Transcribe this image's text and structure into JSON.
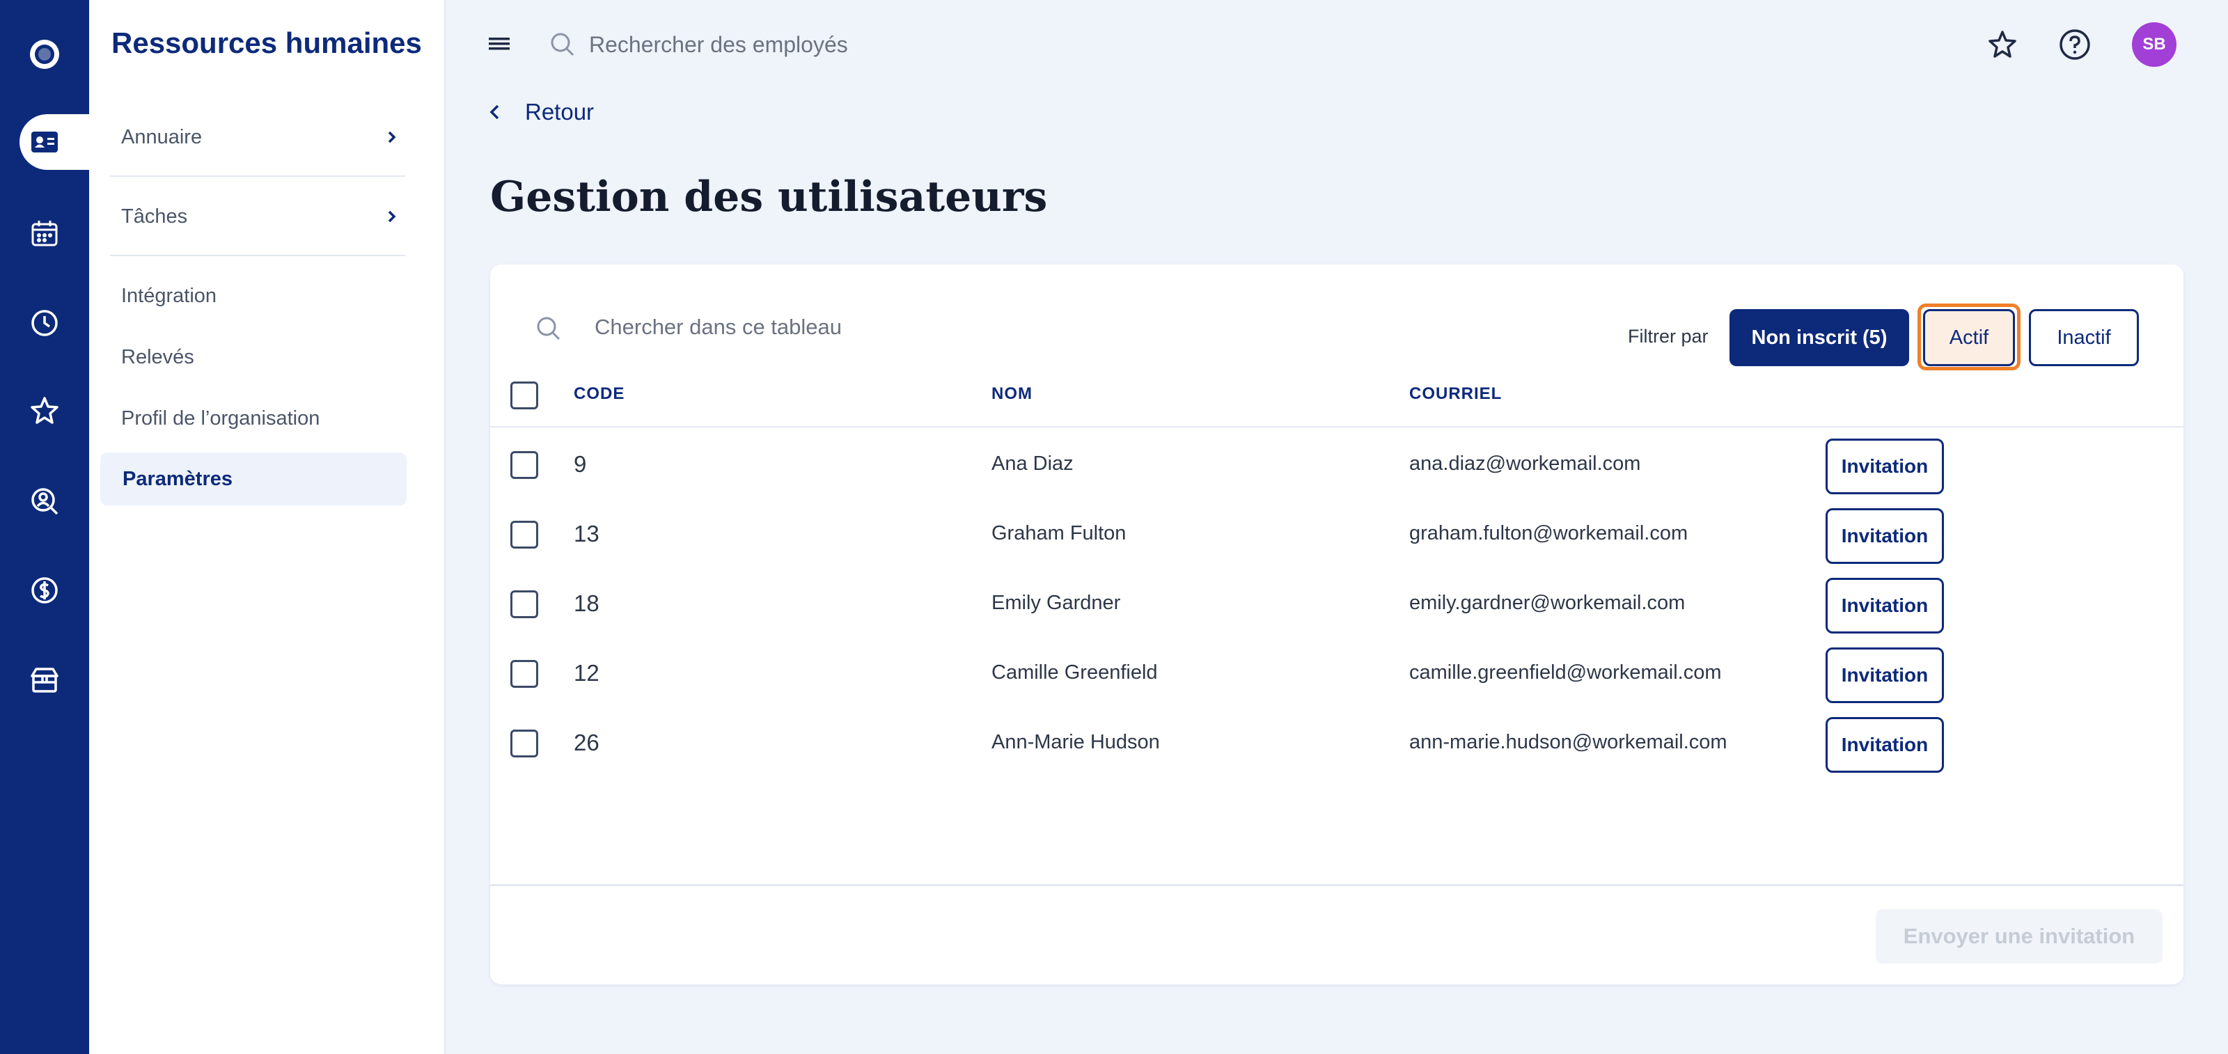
{
  "colors": {
    "brand": "#0d2a7a",
    "accent_focus": "#f07f2a",
    "avatar": "#a13fd6",
    "background": "#eff3fa"
  },
  "rail": {
    "icons": [
      "logo-icon",
      "employee-card-icon",
      "calendar-icon",
      "clock-icon",
      "star-icon",
      "search-person-icon",
      "dollar-icon",
      "gift-icon"
    ]
  },
  "sidebar": {
    "title": "Ressources humaines",
    "items": [
      {
        "label": "Annuaire"
      },
      {
        "label": "Tâches"
      },
      {
        "label": "Intégration"
      },
      {
        "label": "Relevés"
      },
      {
        "label": "Profil de l’organisation"
      },
      {
        "label": "Paramètres"
      }
    ]
  },
  "topbar": {
    "search_placeholder": "Rechercher des employés",
    "avatar_initials": "SB"
  },
  "main": {
    "back_label": "Retour",
    "title": "Gestion des utilisateurs",
    "table_search_placeholder": "Chercher dans ce tableau",
    "filter_label": "Filtrer par",
    "filters": {
      "not_registered": "Non inscrit (5)",
      "active": "Actif",
      "inactive": "Inactif"
    },
    "columns": {
      "code": "CODE",
      "name": "NOM",
      "email": "COURRIEL"
    },
    "rows": [
      {
        "code": "9",
        "name": "Ana Diaz",
        "email": "ana.diaz@workemail.com",
        "action": "Invitation"
      },
      {
        "code": "13",
        "name": "Graham Fulton",
        "email": "graham.fulton@workemail.com",
        "action": "Invitation"
      },
      {
        "code": "18",
        "name": "Emily Gardner",
        "email": "emily.gardner@workemail.com",
        "action": "Invitation"
      },
      {
        "code": "12",
        "name": "Camille Greenfield",
        "email": "camille.greenfield@workemail.com",
        "action": "Invitation"
      },
      {
        "code": "26",
        "name": "Ann-Marie Hudson",
        "email": "ann-marie.hudson@workemail.com",
        "action": "Invitation"
      }
    ],
    "send_button": "Envoyer une invitation"
  }
}
